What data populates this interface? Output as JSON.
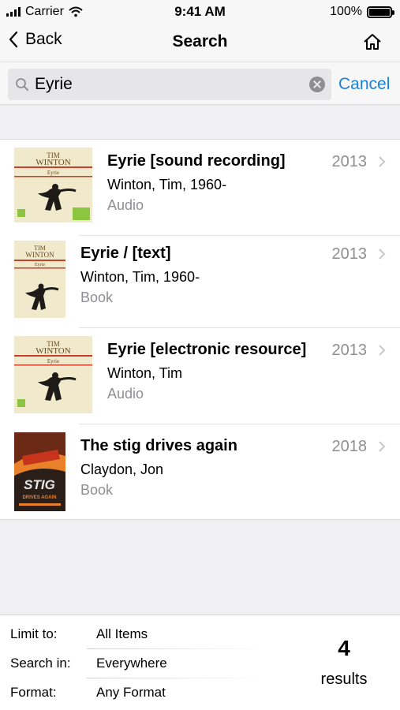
{
  "status_bar": {
    "carrier": "Carrier",
    "time": "9:41 AM",
    "battery": "100%",
    "icons": [
      "signal-icon",
      "wifi-icon",
      "battery-icon"
    ]
  },
  "nav": {
    "back_label": "Back",
    "title": "Search",
    "home_icon": "home-icon"
  },
  "search": {
    "query": "Eyrie",
    "cancel_label": "Cancel",
    "icons": [
      "search-icon",
      "clear-icon"
    ]
  },
  "results": [
    {
      "title": "Eyrie [sound recording]",
      "author": "Winton, Tim, 1960-",
      "format": "Audio",
      "year": "2013"
    },
    {
      "title": "Eyrie / [text]",
      "author": "Winton, Tim, 1960-",
      "format": "Book",
      "year": "2013"
    },
    {
      "title": "Eyrie [electronic resource]",
      "author": "Winton, Tim",
      "format": "Audio",
      "year": "2013"
    },
    {
      "title": "The stig drives again",
      "author": "Claydon, Jon",
      "format": "Book",
      "year": "2018"
    }
  ],
  "covers": {
    "winton_top": "TIM",
    "winton_name": "WINTON",
    "winton_title": "Eyrie",
    "stig_title": "STIG",
    "stig_sub": "DRIVES AGAIN",
    "colors": {
      "cream": "#efe7c6",
      "red_band": "#c9412b",
      "stig_bg": "#2a1e18",
      "stig_orange": "#e8812a"
    }
  },
  "filters": {
    "limit": {
      "label": "Limit to:",
      "value": "All Items"
    },
    "search_in": {
      "label": "Search in:",
      "value": "Everywhere"
    },
    "format": {
      "label": "Format:",
      "value": "Any Format"
    }
  },
  "summary": {
    "count": "4",
    "label": "results"
  },
  "colors": {
    "accent": "#1a82dc",
    "secondary_text": "#8e8e93",
    "grouped_bg": "#efeff4"
  }
}
